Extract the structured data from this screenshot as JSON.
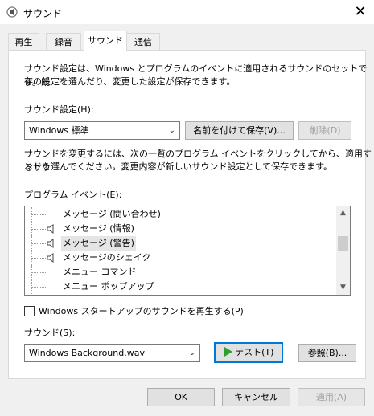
{
  "window": {
    "title": "サウンド",
    "close_glyph": "✕"
  },
  "tabs": [
    {
      "label": "再生"
    },
    {
      "label": "録音"
    },
    {
      "label": "サウンド"
    },
    {
      "label": "通信"
    }
  ],
  "description": {
    "line1": "サウンド設定は、Windows とプログラムのイベントに適用されるサウンドのセットです。既",
    "line2": "存の設定を選んだり、変更した設定が保存できます。"
  },
  "scheme": {
    "label": "サウンド設定(H):",
    "selected": "Windows 標準",
    "save_as_label": "名前を付けて保存(V)...",
    "delete_label": "削除(D)"
  },
  "instructions": {
    "line1": "サウンドを変更するには、次の一覧のプログラム イベントをクリックしてから、適用するサウ",
    "line2": "ンドを選んでください。変更内容が新しいサウンド設定として保存できます。"
  },
  "events": {
    "label": "プログラム イベント(E):",
    "items": [
      {
        "label": "メッセージ (問い合わせ)",
        "has_sound": false,
        "selected": false
      },
      {
        "label": "メッセージ (情報)",
        "has_sound": true,
        "selected": false
      },
      {
        "label": "メッセージ (警告)",
        "has_sound": true,
        "selected": true
      },
      {
        "label": "メッセージのシェイク",
        "has_sound": true,
        "selected": false
      },
      {
        "label": "メニュー コマンド",
        "has_sound": false,
        "selected": false
      },
      {
        "label": "メニュー ポップアップ",
        "has_sound": false,
        "selected": false
      }
    ]
  },
  "startup": {
    "label": "Windows スタートアップのサウンドを再生する(P)",
    "checked": false
  },
  "sound": {
    "label": "サウンド(S):",
    "selected": "Windows Background.wav",
    "test_label": "テスト(T)",
    "browse_label": "参照(B)..."
  },
  "footer": {
    "ok_label": "OK",
    "cancel_label": "キャンセル",
    "apply_label": "適用(A)"
  },
  "colors": {
    "accent": "#0078d7",
    "play_green": "#2e9e2e"
  }
}
